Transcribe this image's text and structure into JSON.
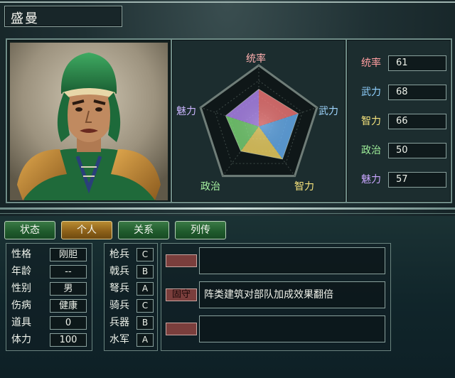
{
  "character": {
    "name": "盛曼"
  },
  "colors": {
    "tab_active": "#b98c32",
    "tab_inactive": "#2a6a36",
    "radar_fill": "rainbow-gradient"
  },
  "radar": {
    "labels": {
      "top": "统率",
      "right": "武力",
      "bottom_right": "智力",
      "bottom_left": "政治",
      "left": "魅力"
    }
  },
  "stats": [
    {
      "label": "统率",
      "value": "61",
      "color": "#ff9ea0"
    },
    {
      "label": "武力",
      "value": "68",
      "color": "#8fd0ff"
    },
    {
      "label": "智力",
      "value": "66",
      "color": "#f4e27c"
    },
    {
      "label": "政治",
      "value": "50",
      "color": "#9ff09a"
    },
    {
      "label": "魅力",
      "value": "57",
      "color": "#c9a6ff"
    }
  ],
  "tabs": [
    {
      "label": "状态",
      "active": false
    },
    {
      "label": "个人",
      "active": true
    },
    {
      "label": "关系",
      "active": false
    },
    {
      "label": "列传",
      "active": false
    }
  ],
  "attributes": [
    {
      "label": "性格",
      "value": "刚胆"
    },
    {
      "label": "年龄",
      "value": "--"
    },
    {
      "label": "性别",
      "value": "男"
    },
    {
      "label": "伤病",
      "value": "健康"
    },
    {
      "label": "道具",
      "value": "0"
    },
    {
      "label": "体力",
      "value": "100"
    }
  ],
  "troops": [
    {
      "label": "枪兵",
      "grade": "C"
    },
    {
      "label": "戟兵",
      "grade": "B"
    },
    {
      "label": "弩兵",
      "grade": "A"
    },
    {
      "label": "骑兵",
      "grade": "C"
    },
    {
      "label": "兵器",
      "grade": "B"
    },
    {
      "label": "水军",
      "grade": "A"
    }
  ],
  "skills": [
    {
      "tag": "",
      "description": ""
    },
    {
      "tag": "固守",
      "description": "阵类建筑对部队加成效果翻倍"
    },
    {
      "tag": "",
      "description": ""
    }
  ],
  "stat_levels": {
    "统率": 61,
    "武力": 68,
    "智力": 66,
    "政治": 50,
    "魅力": 57
  }
}
